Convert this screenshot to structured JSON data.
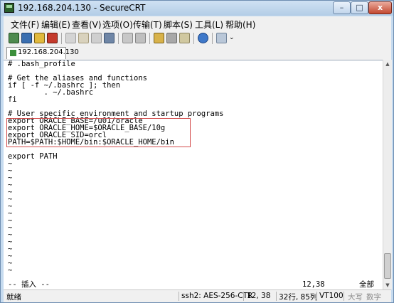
{
  "window": {
    "title": "192.168.204.130 - SecureCRT",
    "minimize_glyph": "–",
    "maximize_glyph": "□",
    "close_glyph": "x"
  },
  "menu": [
    "文件(F)",
    "编辑(E)",
    "查看(V)",
    "选项(O)",
    "传输(T)",
    "脚本(S)",
    "工具(L)",
    "帮助(H)"
  ],
  "toolbar": {
    "icons": [
      "connect-icon",
      "quick-connect-icon",
      "reconnect-icon",
      "disconnect-icon",
      "copy-icon",
      "paste-icon",
      "copy-paste-icon",
      "find-icon",
      "print-icon",
      "print-screen-icon",
      "session-options-icon",
      "global-options-icon",
      "keymap-icon",
      "help-icon",
      "sftp-icon"
    ],
    "more_glyph": "⌄"
  },
  "tabs": [
    {
      "label": "192.168.204.130",
      "active": true
    }
  ],
  "terminal": {
    "lines": [
      "# .bash_profile",
      "",
      "# Get the aliases and functions",
      "if [ -f ~/.bashrc ]; then",
      "        . ~/.bashrc",
      "fi",
      "",
      "# User specific environment and startup programs",
      "export ORACLE_BASE=/u01/oracle",
      "export ORACLE_HOME=$ORACLE_BASE/10g",
      "export ORACLE_SID=orcl",
      "PATH=$PATH:$HOME/bin:$ORACLE_HOME/bin",
      "",
      "export PATH",
      "~",
      "~",
      "~",
      "~",
      "~",
      "~",
      "~",
      "~",
      "~",
      "~",
      "~",
      "~",
      "~",
      "~",
      "~",
      "~"
    ],
    "mode_line": "-- 插入 --",
    "cursor_pos": "12,38",
    "scroll_pos": "全部",
    "highlight_color": "#d34a4a"
  },
  "scrollbar": {
    "up_glyph": "▲",
    "down_glyph": "▼"
  },
  "statusbar": {
    "ready": "就绪",
    "encryption": "ssh2: AES-256-CTR",
    "position": "12,  38",
    "size": "32行, 85列",
    "terminal_type": "VT100",
    "caps": "大写",
    "num": "数字"
  }
}
